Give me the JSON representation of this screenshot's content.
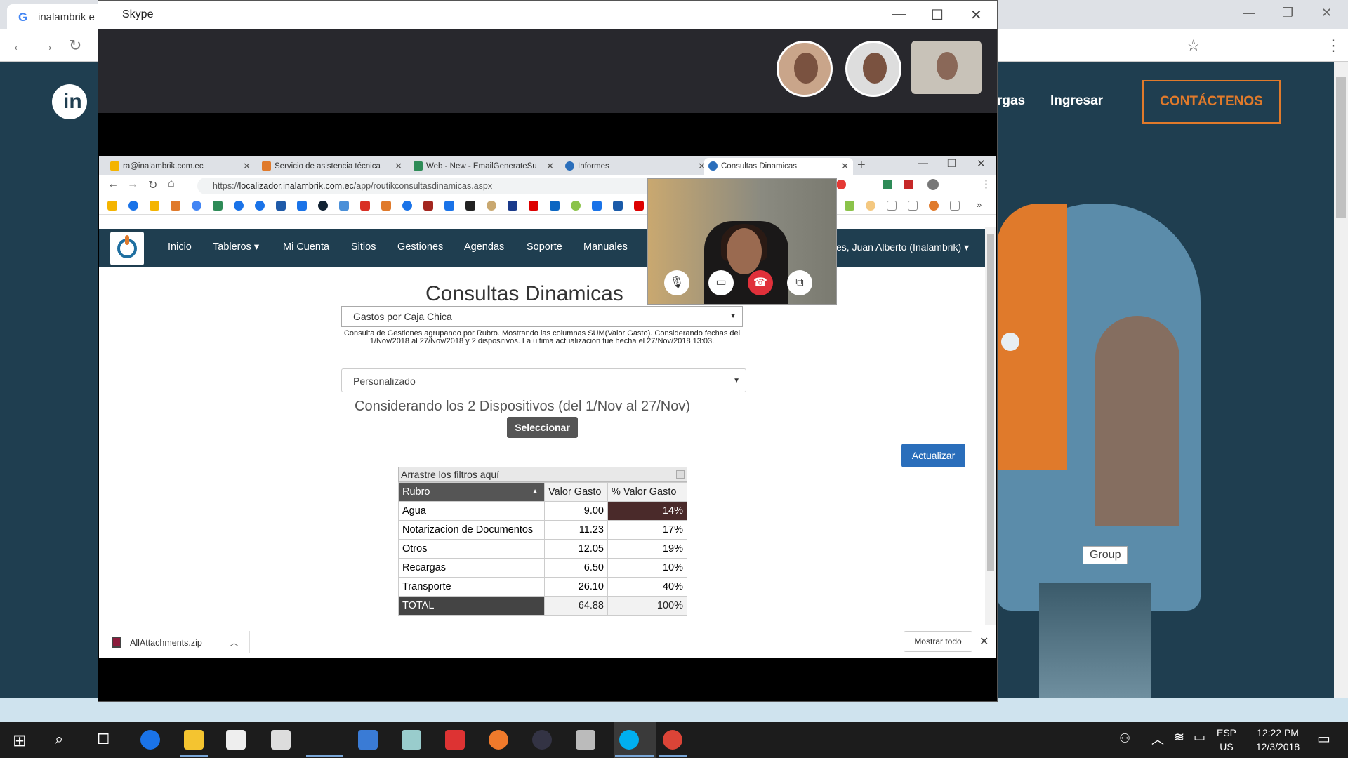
{
  "background_browser": {
    "tab_title": "inalambrik e",
    "nav": {
      "cargas": "rgas",
      "ingresar": "Ingresar",
      "contact": "CONTÁCTENOS"
    },
    "group_tag": "Group"
  },
  "skype": {
    "title": "Skype"
  },
  "inner_browser": {
    "tabs": [
      {
        "label": "ra@inalambrik.com.ec",
        "icon_color": "#f4b400"
      },
      {
        "label": "Servicio de asistencia técnica",
        "icon_color": "#e07a2b"
      },
      {
        "label": "Web - New - EmailGenerateSu",
        "icon_color": "#2e8b57"
      },
      {
        "label": "Informes",
        "icon_color": "#2a6ebb"
      },
      {
        "label": "Consultas Dinamicas",
        "icon_color": "#2a6ebb"
      }
    ],
    "url_prefix": "https://",
    "url_host": "localizador.inalambrik.com.ec",
    "url_path": "/app/routikconsultasdinamicas.aspx"
  },
  "site_nav": {
    "items": [
      "Inicio",
      "Tableros ▾",
      "Mi Cuenta",
      "Sitios",
      "Gestiones",
      "Agendas",
      "Soporte",
      "Manuales"
    ],
    "user": "es, Juan Alberto (Inalambrik) ▾"
  },
  "page": {
    "title": "Consultas Dinamicas",
    "report_select": "Gastos por Caja Chica",
    "description": "Consulta de Gestiones agrupando por Rubro. Mostrando las columnas SUM(Valor Gasto). Considerando fechas del 1/Nov/2018 al 27/Nov/2018 y 2 dispositivos. La ultima actualizacion fue hecha el 27/Nov/2018 13:03.",
    "period_select": "Personalizado",
    "devices_text": "Considerando los 2 Dispositivos (del 1/Nov al 27/Nov)",
    "select_button": "Seleccionar",
    "update_button": "Actualizar"
  },
  "pivot": {
    "filters_label": "Arrastre los filtros aquí",
    "headers": [
      "Rubro",
      "Valor Gasto",
      "% Valor Gasto"
    ],
    "rows": [
      {
        "rubro": "Agua",
        "valor": "9.00",
        "pct": "14%"
      },
      {
        "rubro": "Notarizacion de Documentos",
        "valor": "11.23",
        "pct": "17%"
      },
      {
        "rubro": "Otros",
        "valor": "12.05",
        "pct": "19%"
      },
      {
        "rubro": "Recargas",
        "valor": "6.50",
        "pct": "10%"
      },
      {
        "rubro": "Transporte",
        "valor": "26.10",
        "pct": "40%"
      }
    ],
    "total": {
      "rubro": "TOTAL",
      "valor": "64.88",
      "pct": "100%"
    }
  },
  "downloads": {
    "file": "AllAttachments.zip",
    "show_all": "Mostrar todo"
  },
  "taskbar": {
    "lang_top": "ESP",
    "lang_bottom": "US",
    "time": "12:22 PM",
    "date": "12/3/2018"
  }
}
